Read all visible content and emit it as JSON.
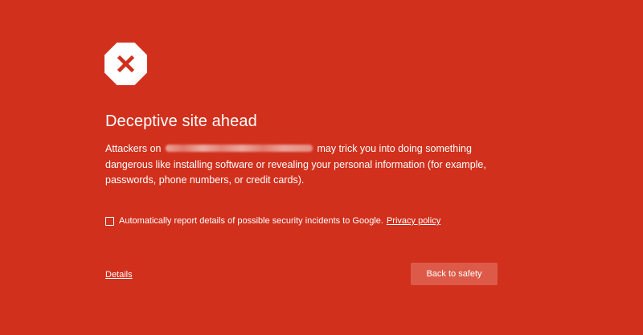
{
  "interstitial": {
    "icon": "stop-x-icon",
    "title": "Deceptive site ahead",
    "body_prefix": "Attackers on",
    "body_suffix": "may trick you into doing something dangerous like installing software or revealing your personal information (for example, passwords, phone numbers, or credit cards).",
    "report_checkbox_checked": false,
    "report_label": "Automatically report details of possible security incidents to Google.",
    "privacy_link": "Privacy policy",
    "details_link": "Details",
    "back_button": "Back to safety"
  },
  "colors": {
    "background": "#d0301c",
    "button_background": "#dd5a48",
    "icon_fill": "#ffffff",
    "icon_x": "#d0301c"
  }
}
